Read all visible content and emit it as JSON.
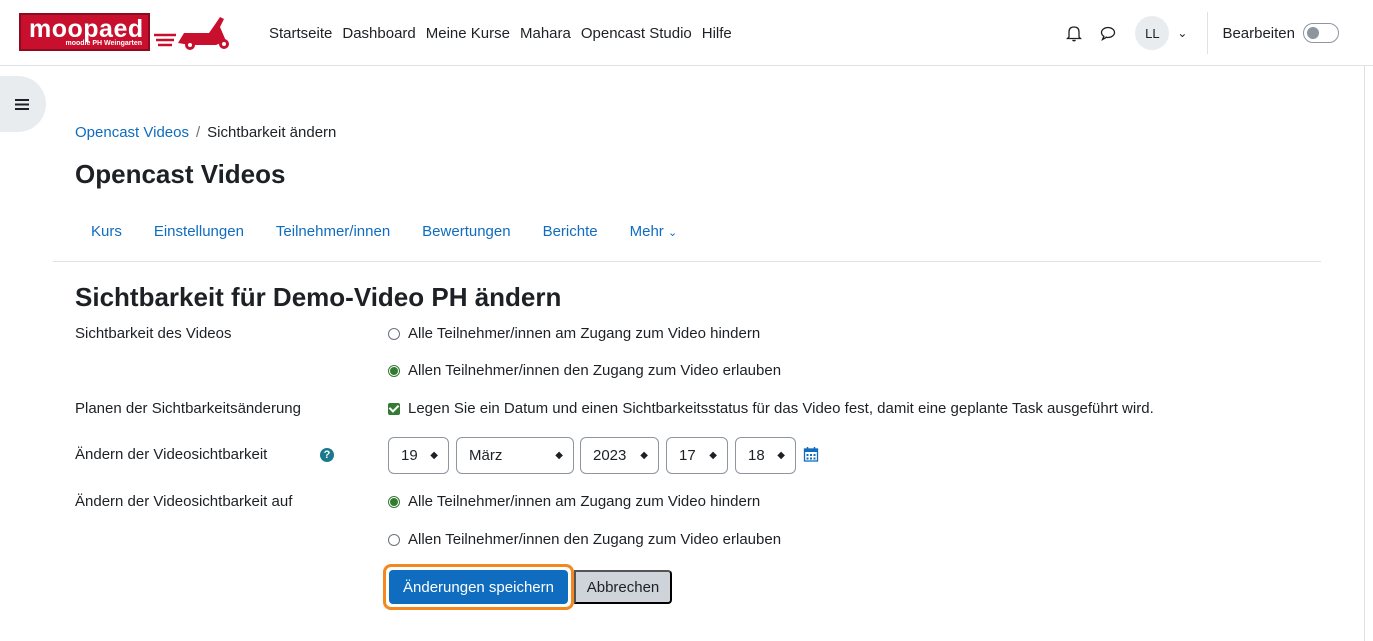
{
  "logo": {
    "main": "moopaed",
    "sub": "moodle PH Weingarten"
  },
  "nav": {
    "items": [
      "Startseite",
      "Dashboard",
      "Meine Kurse",
      "Mahara",
      "Opencast Studio",
      "Hilfe"
    ],
    "avatar": "LL",
    "edit_label": "Bearbeiten"
  },
  "breadcrumb": {
    "parent": "Opencast Videos",
    "separator": "/",
    "current": "Sichtbarkeit ändern"
  },
  "page_title": "Opencast Videos",
  "secondary_nav": [
    "Kurs",
    "Einstellungen",
    "Teilnehmer/innen",
    "Bewertungen",
    "Berichte",
    "Mehr"
  ],
  "form": {
    "title": "Sichtbarkeit für Demo-Video PH ändern",
    "visibility": {
      "label": "Sichtbarkeit des Videos",
      "options": [
        "Alle Teilnehmer/innen am Zugang zum Video hindern",
        "Allen Teilnehmer/innen den Zugang zum Video erlauben"
      ],
      "selected": 1
    },
    "schedule": {
      "label": "Planen der Sichtbarkeitsänderung",
      "checkbox_text": "Legen Sie ein Datum und einen Sichtbarkeitsstatus für das Video fest, damit eine geplante Task ausgeführt wird.",
      "checked": true
    },
    "change_date": {
      "label": "Ändern der Videosichtbarkeit",
      "day": "19",
      "month": "März",
      "year": "2023",
      "hour": "17",
      "minute": "18"
    },
    "change_to": {
      "label": "Ändern der Videosichtbarkeit auf",
      "options": [
        "Alle Teilnehmer/innen am Zugang zum Video hindern",
        "Allen Teilnehmer/innen den Zugang zum Video erlauben"
      ],
      "selected": 0
    },
    "save_label": "Änderungen speichern",
    "cancel_label": "Abbrechen"
  },
  "colors": {
    "accent": "#0f6cbf",
    "logo_red": "#c8102e",
    "success": "#357a32",
    "highlight": "#f5871f"
  }
}
